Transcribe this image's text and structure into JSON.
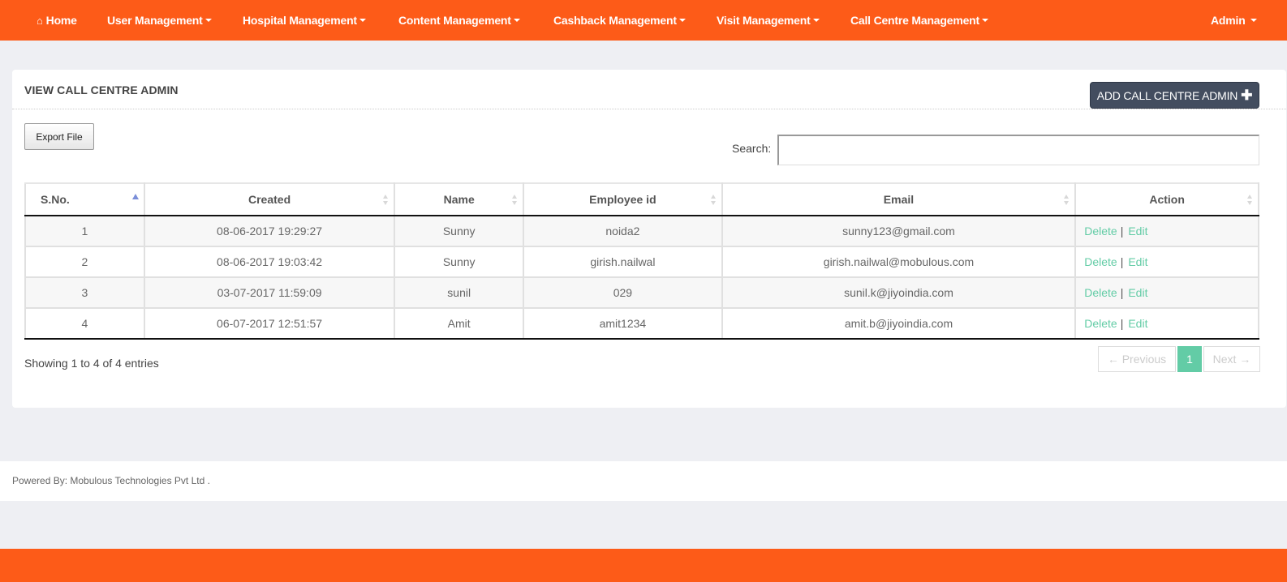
{
  "nav": {
    "home": "Home",
    "items": [
      {
        "label": "User Management"
      },
      {
        "label": "Hospital Management"
      },
      {
        "label": "Content Management"
      },
      {
        "label": "Cashback Management"
      },
      {
        "label": "Visit Management"
      },
      {
        "label": "Call Centre Management"
      }
    ],
    "user": "Admin",
    "brand_color": "#fd5b18"
  },
  "panel": {
    "title": "VIEW CALL CENTRE ADMIN",
    "add_button": "ADD CALL CENTRE ADMIN",
    "export_button": "Export File",
    "search_label": "Search:",
    "search_value": ""
  },
  "table": {
    "columns": [
      "S.No.",
      "Created",
      "Name",
      "Employee id",
      "Email",
      "Action"
    ],
    "sorted_column": "S.No.",
    "sort_direction": "asc",
    "rows": [
      {
        "sno": "1",
        "created": "08-06-2017 19:29:27",
        "name": "Sunny",
        "employee_id": "noida2",
        "email": "sunny123@gmail.com"
      },
      {
        "sno": "2",
        "created": "08-06-2017 19:03:42",
        "name": "Sunny",
        "employee_id": "girish.nailwal",
        "email": "girish.nailwal@mobulous.com"
      },
      {
        "sno": "3",
        "created": "03-07-2017 11:59:09",
        "name": "sunil",
        "employee_id": "029",
        "email": "sunil.k@jiyoindia.com"
      },
      {
        "sno": "4",
        "created": "06-07-2017 12:51:57",
        "name": "Amit",
        "employee_id": "amit1234",
        "email": "amit.b@jiyoindia.com"
      }
    ],
    "actions": {
      "delete": "Delete",
      "separator": "|",
      "edit": "Edit"
    }
  },
  "pagination": {
    "info": "Showing 1 to 4 of 4 entries",
    "previous": "← Previous",
    "current": "1",
    "next": "Next →",
    "accent_color": "#63cca6"
  },
  "footer": {
    "text": "Powered By: Mobulous Technologies Pvt Ltd ."
  }
}
